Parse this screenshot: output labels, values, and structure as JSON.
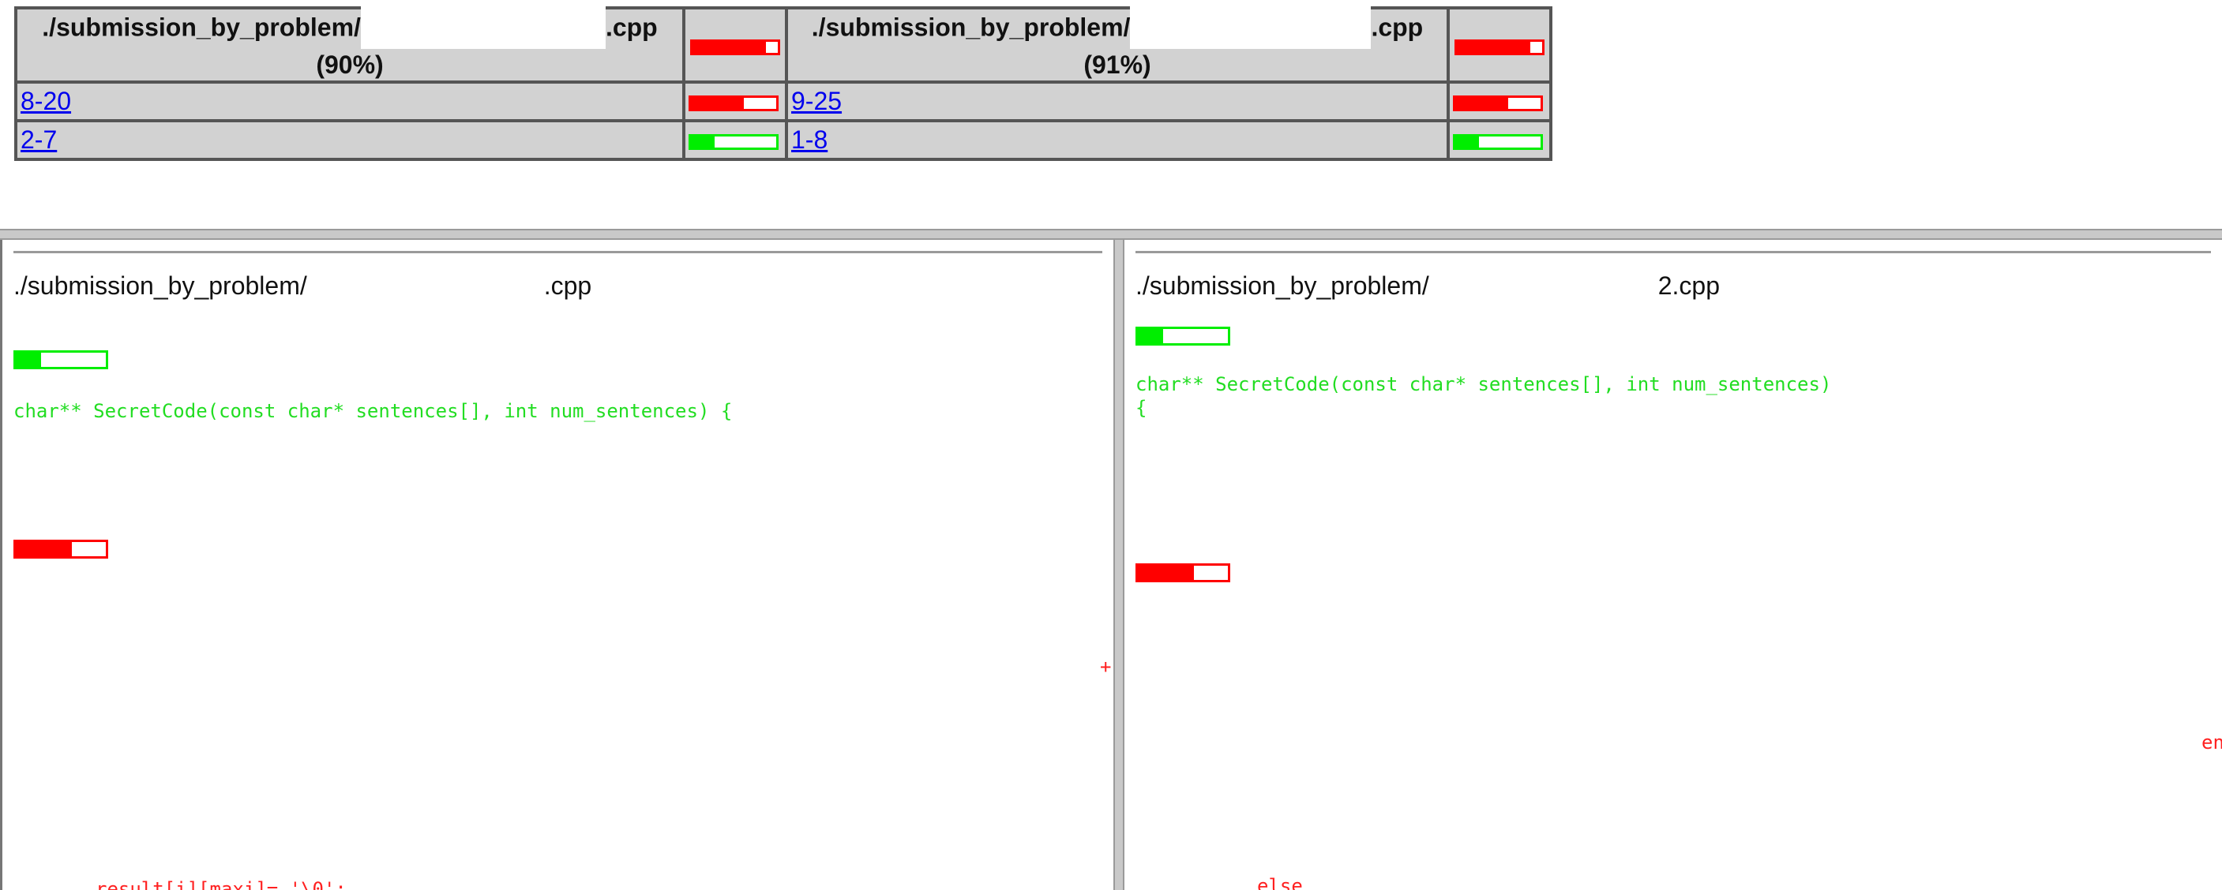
{
  "match_table": {
    "file1": {
      "prefix": "./submission_by_problem/",
      "suffix": ".cpp",
      "percent": "(90%)",
      "bar_fill": 0.86
    },
    "file2": {
      "prefix": "./submission_by_problem/",
      "suffix": ".cpp",
      "percent": "(91%)",
      "bar_fill": 0.86
    },
    "rows": [
      {
        "left_link": "8-20",
        "left_bar_fill": 0.62,
        "left_color": "red",
        "right_link": "9-25",
        "right_bar_fill": 0.62,
        "right_color": "red"
      },
      {
        "left_link": "2-7",
        "left_bar_fill": 0.28,
        "left_color": "green",
        "right_link": "1-8",
        "right_bar_fill": 0.28,
        "right_color": "green"
      }
    ]
  },
  "left_pane": {
    "title_prefix": "./submission_by_problem/",
    "title_suffix": ".cpp",
    "code_line_1": "char** SecretCode(const char* sentences[], int num_sentences) {",
    "marker": "+",
    "bottom_line": "result[i][maxi]= '\\0';"
  },
  "right_pane": {
    "title_prefix": "./submission_by_problem/",
    "title_suffix": "2.cpp",
    "code_line_1": "char** SecretCode(const char* sentences[], int num_sentences)",
    "code_line_2": "{",
    "fragment_en": "en",
    "bottom_line": "else"
  },
  "colors": {
    "match_red": "#ff0000",
    "match_green": "#00ee00",
    "link": "#0000ee"
  }
}
